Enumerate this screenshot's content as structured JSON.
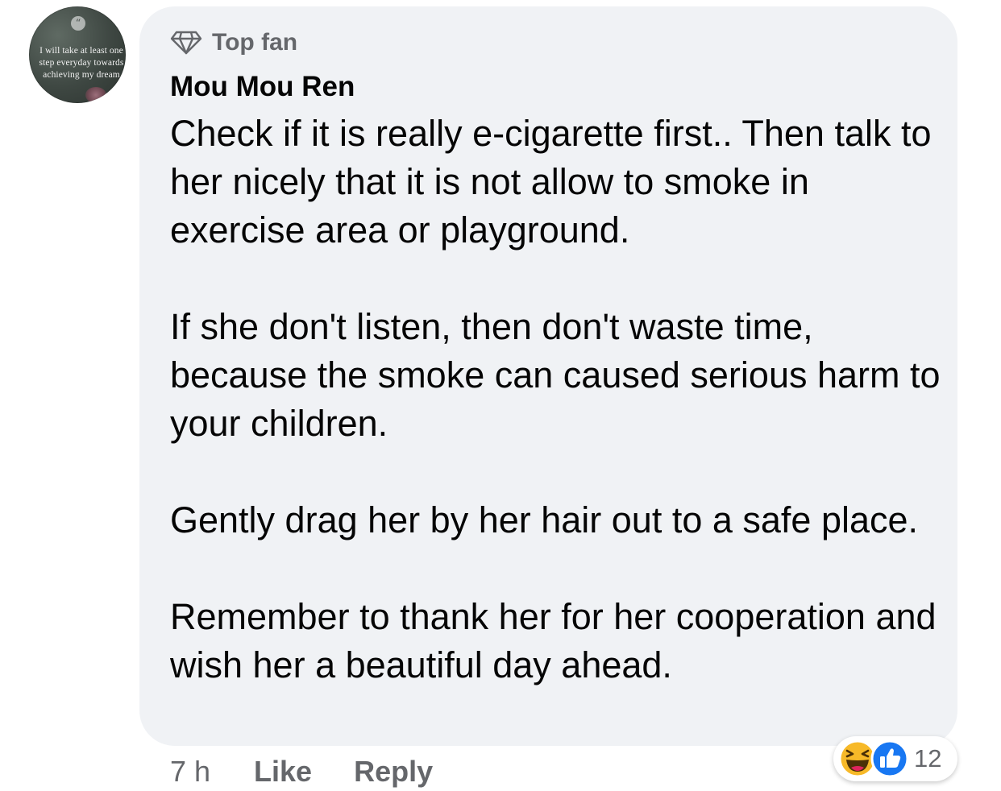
{
  "avatar": {
    "text": "I will take at least one step everyday towards achieving my dream"
  },
  "comment": {
    "badge": "Top fan",
    "author": "Mou Mou Ren",
    "paragraphs": [
      "Check if it is really e-cigarette first.. Then talk to her nicely that it is not allow to smoke in exercise area or playground.",
      "If she don't listen, then don't waste time, because the smoke can caused serious harm to your children.",
      "Gently drag her by her hair out to a safe place.",
      "Remember to thank her for her cooperation and wish her a beautiful day ahead."
    ],
    "time": "7 h",
    "like_label": "Like",
    "reply_label": "Reply"
  },
  "reactions": {
    "icons": [
      "haha-icon",
      "like-icon"
    ],
    "count": "12"
  },
  "colors": {
    "bubble": "#f0f2f5",
    "secondary_text": "#65676b",
    "like_blue": "#1877f2",
    "haha_yellow": "#f7b928"
  }
}
